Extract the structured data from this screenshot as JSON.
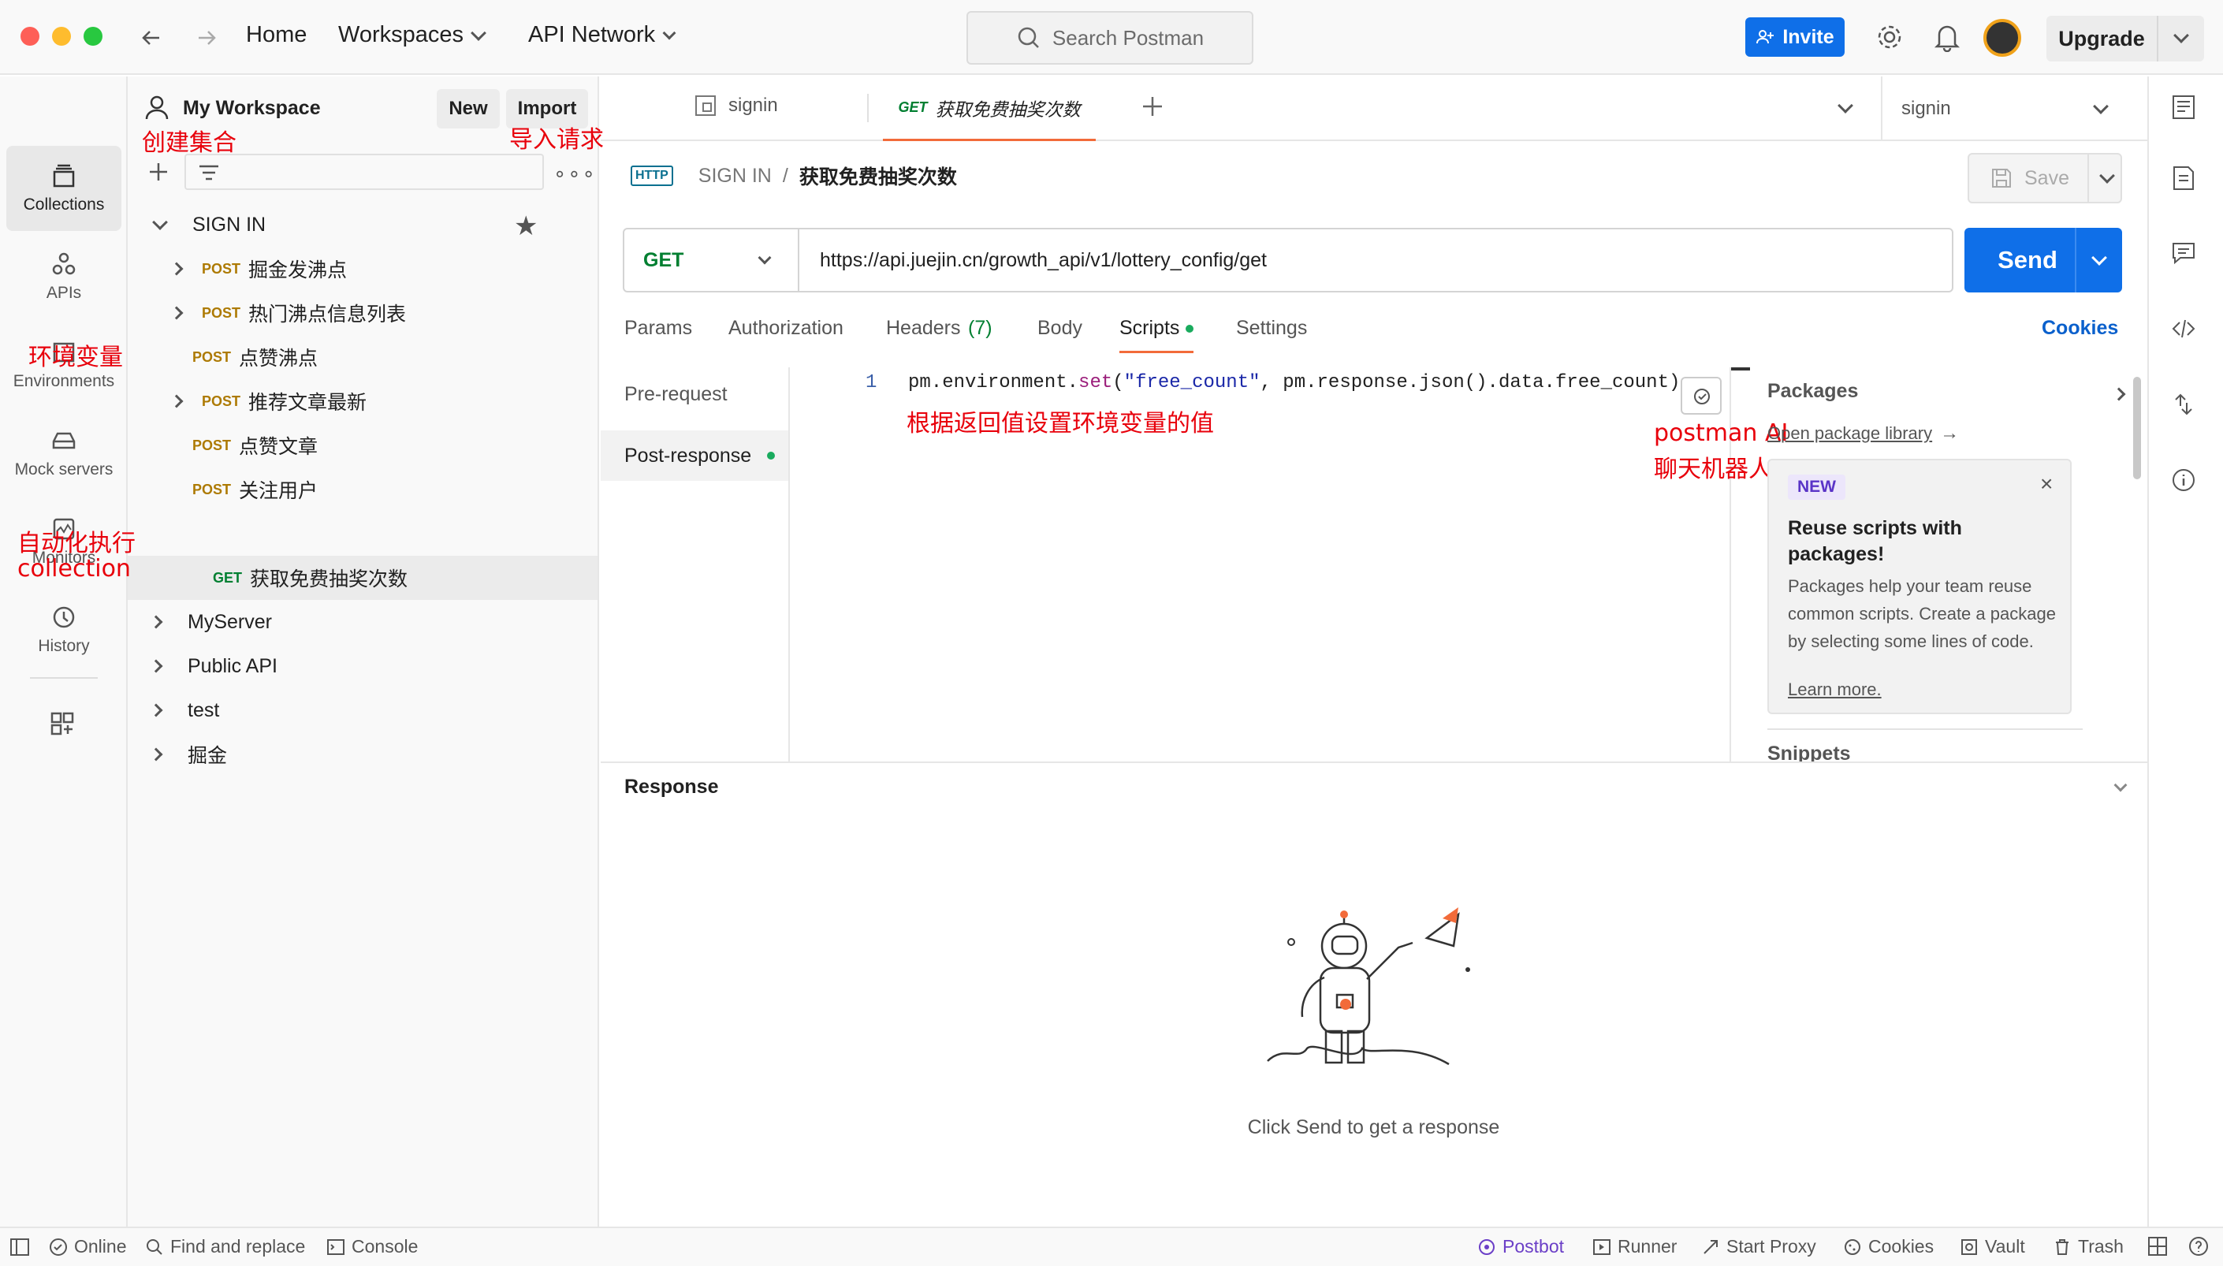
{
  "topbar": {
    "home": "Home",
    "workspaces": "Workspaces",
    "api_network": "API Network",
    "search_placeholder": "Search Postman",
    "invite": "Invite",
    "upgrade": "Upgrade"
  },
  "rail": {
    "items": [
      {
        "label": "Collections",
        "icon": "collections-icon"
      },
      {
        "label": "APIs",
        "icon": "apis-icon"
      },
      {
        "label": "Environments",
        "icon": "environments-icon"
      },
      {
        "label": "Mock servers",
        "icon": "mock-servers-icon"
      },
      {
        "label": "Monitors",
        "icon": "monitors-icon"
      },
      {
        "label": "History",
        "icon": "history-icon"
      }
    ]
  },
  "sidebar": {
    "workspace": "My Workspace",
    "new": "New",
    "import": "Import",
    "collection": "SIGN IN",
    "requests": [
      {
        "method": "POST",
        "name": "掘金发沸点",
        "expandable": true
      },
      {
        "method": "POST",
        "name": "热门沸点信息列表",
        "expandable": true
      },
      {
        "method": "POST",
        "name": "点赞沸点",
        "expandable": false
      },
      {
        "method": "POST",
        "name": "推荐文章最新",
        "expandable": true
      },
      {
        "method": "POST",
        "name": "点赞文章",
        "expandable": false
      },
      {
        "method": "POST",
        "name": "关注用户",
        "expandable": false
      },
      {
        "method": "GET",
        "name": "获取免费抽奖次数",
        "expandable": false
      }
    ],
    "other_collections": [
      "MyServer",
      "Public API",
      "test",
      "掘金"
    ]
  },
  "annotations": {
    "create_collection": "创建集合",
    "import_request": "导入请求",
    "env_var": "环境变量",
    "auto_exec_1": "自动化执行",
    "auto_exec_2": "collection",
    "set_env": "根据返回值设置环境变量的值",
    "ai_1": "postman AI",
    "ai_2": "聊天机器人"
  },
  "tabs": {
    "tab1": "signin",
    "tab2_method": "GET",
    "tab2_name": "获取免费抽奖次数",
    "env": "signin"
  },
  "request": {
    "breadcrumb_parent": "SIGN IN",
    "breadcrumb_sep": "/",
    "name": "获取免费抽奖次数",
    "save": "Save",
    "method": "GET",
    "url": "https://api.juejin.cn/growth_api/v1/lottery_config/get",
    "send": "Send",
    "tabs": [
      "Params",
      "Authorization",
      "Headers",
      "Body",
      "Scripts",
      "Settings"
    ],
    "headers_count": "(7)",
    "cookies": "Cookies",
    "script_tabs": [
      "Pre-request",
      "Post-response"
    ],
    "line_no": "1",
    "code_1": "pm.environment.",
    "code_2": "set",
    "code_3": "(",
    "code_4": "\"free_count\"",
    "code_5": ", pm.response.json().data.free_count)"
  },
  "packages": {
    "title": "Packages",
    "open_lib": "Open package library",
    "badge": "NEW",
    "heading": "Reuse scripts with packages!",
    "body": "Packages help your team reuse common scripts. Create a package by selecting some lines of code.",
    "learn": "Learn more.",
    "snippets": "Snippets"
  },
  "response": {
    "title": "Response",
    "empty": "Click Send to get a response"
  },
  "statusbar": {
    "online": "Online",
    "find": "Find and replace",
    "console": "Console",
    "postbot": "Postbot",
    "runner": "Runner",
    "proxy": "Start Proxy",
    "cookies": "Cookies",
    "vault": "Vault",
    "trash": "Trash"
  }
}
